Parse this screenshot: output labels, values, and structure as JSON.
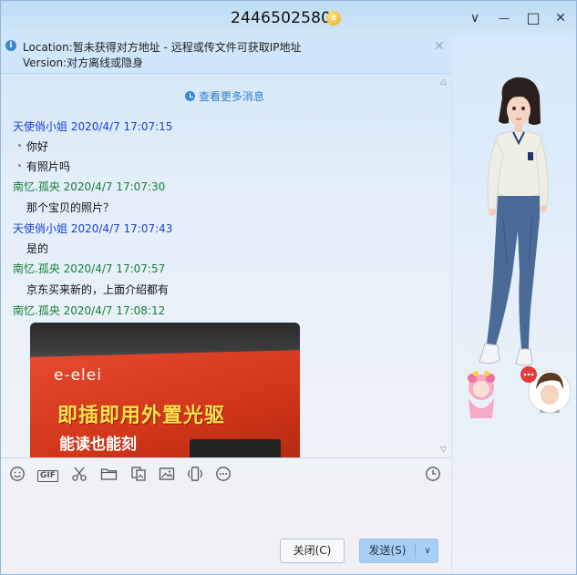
{
  "window": {
    "title": "2446502580",
    "vip_badge": "z",
    "controls": {
      "menu": "∨",
      "minimize": "—",
      "maximize": "□",
      "close": "✕"
    }
  },
  "notice": {
    "line1": "Location:暂未获得对方地址 - 远程或传文件可获取IP地址",
    "line2": "Version:对方离线或隐身",
    "info_icon": "i",
    "close": "✕"
  },
  "chat": {
    "more_messages": "查看更多消息",
    "messages": [
      {
        "sender": "天使俏小姐 2020/4/7 17:07:15",
        "lines": [
          "你好",
          "有照片吗"
        ]
      },
      {
        "sender": "南忆.孤央 2020/4/7 17:07:30",
        "lines": [
          "那个宝贝的照片？"
        ]
      },
      {
        "sender": "天使俏小姐 2020/4/7 17:07:43",
        "lines": [
          "是的"
        ]
      },
      {
        "sender": "南忆.孤央 2020/4/7 17:07:57",
        "lines": [
          "京东买来新的，上面介绍都有"
        ]
      },
      {
        "sender": "南忆.孤央 2020/4/7 17:08:12",
        "image": {
          "brand": "e-elei",
          "headline": "即插即用外置光驱",
          "subline": "能读也能刻"
        }
      }
    ]
  },
  "toolbar": {
    "gif_label": "GIF",
    "icons": [
      "emoji-icon",
      "gif-icon",
      "scissors-icon",
      "folder-icon",
      "image-gallery-icon",
      "picture-icon",
      "phone-shake-icon",
      "more-icon",
      "history-clock-icon"
    ]
  },
  "buttons": {
    "close": "关闭(C)",
    "send": "发送(S)",
    "send_arrow": "∨"
  },
  "colors": {
    "sender_other": "#1a3fd1",
    "sender_self": "#168038",
    "link": "#2f7fd3",
    "send_button": "#a8cef4"
  }
}
